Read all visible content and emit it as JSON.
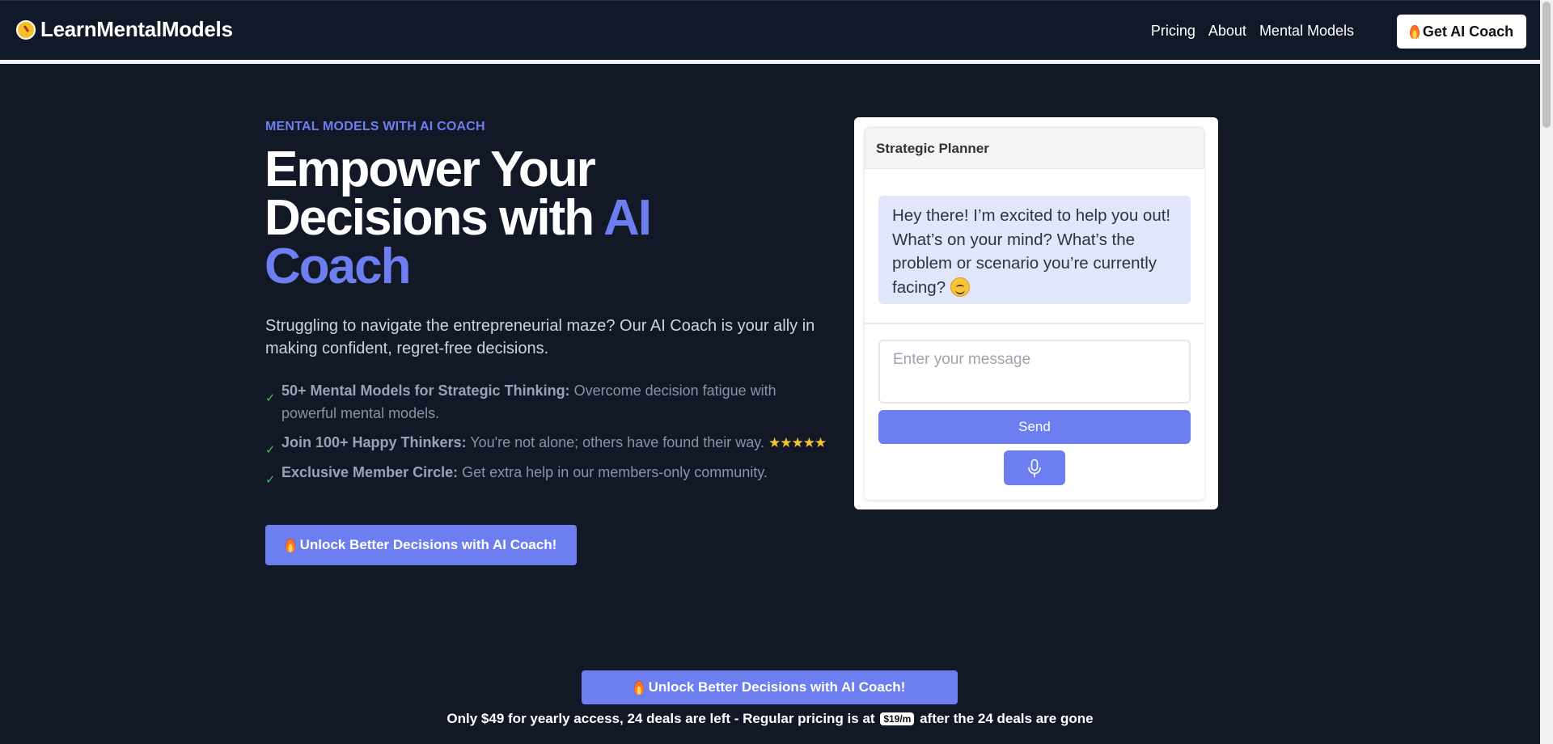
{
  "nav": {
    "brand": "LearnMentalModels",
    "links": [
      "Pricing",
      "About",
      "Mental Models"
    ],
    "cta_label": "Get AI Coach"
  },
  "hero": {
    "eyebrow": "MENTAL MODELS WITH AI COACH",
    "headline_line1": "Empower Your",
    "headline_line2": "Decisions with",
    "headline_accent": "AI Coach",
    "subhead": "Struggling to navigate the entrepreneurial maze? Our AI Coach is your ally in making confident, regret-free decisions.",
    "features": [
      {
        "title": "50+ Mental Models for Strategic Thinking:",
        "text": "Overcome decision fatigue with powerful mental models."
      },
      {
        "title": "Join 100+ Happy Thinkers:",
        "text": "You're not alone; others have found their way.",
        "stars": "★★★★★"
      },
      {
        "title": "Exclusive Member Circle:",
        "text": "Get extra help in our members-only community."
      }
    ],
    "cta_label": "Unlock Better Decisions with AI Coach!"
  },
  "chat": {
    "title": "Strategic Planner",
    "bot_message": "Hey there! I’m excited to help you out! What’s on your mind? What’s the problem or scenario you’re currently facing?",
    "input_placeholder": "Enter your message",
    "send_label": "Send"
  },
  "footer_cta": {
    "label": "Unlock Better Decisions with AI Coach!",
    "pricing_before": "Only $49 for yearly access, 24 deals are left - Regular pricing is at",
    "price_badge": "$19/m",
    "pricing_after": "after the 24 deals are gone"
  },
  "colors": {
    "background": "#121826",
    "accent": "#6c7ef0",
    "check": "#34c06a",
    "stars": "#f2c530"
  }
}
